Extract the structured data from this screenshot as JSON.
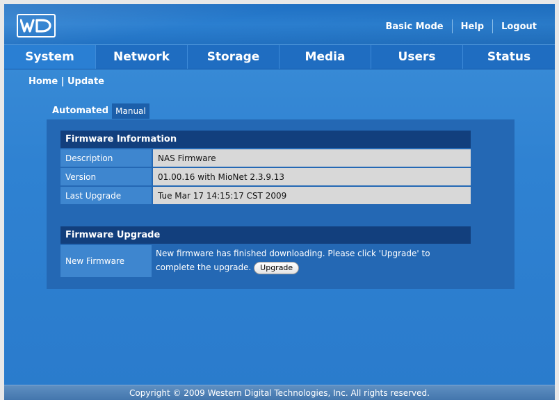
{
  "brand": "WD",
  "top_links": [
    "Basic Mode",
    "Help",
    "Logout"
  ],
  "nav": [
    "System",
    "Network",
    "Storage",
    "Media",
    "Users",
    "Status"
  ],
  "breadcrumb": {
    "home": "Home",
    "sep": "|",
    "current": "Update"
  },
  "tabs": {
    "automated": "Automated",
    "manual": "Manual"
  },
  "firmware_info": {
    "title": "Firmware Information",
    "rows": [
      {
        "label": "Description",
        "value": "NAS Firmware"
      },
      {
        "label": "Version",
        "value": "01.00.16 with MioNet 2.3.9.13"
      },
      {
        "label": "Last Upgrade",
        "value": "Tue Mar 17 14:15:17 CST 2009"
      }
    ]
  },
  "firmware_upgrade": {
    "title": "Firmware Upgrade",
    "label": "New Firmware",
    "message": "New firmware has finished downloading. Please click 'Upgrade' to complete the upgrade.",
    "button": "Upgrade"
  },
  "footer": "Copyright © 2009 Western Digital Technologies, Inc. All rights reserved.",
  "colors": {
    "accent": "#2a7bcc",
    "header_dark": "#123f7d",
    "value_bg": "#d8d8d8"
  }
}
